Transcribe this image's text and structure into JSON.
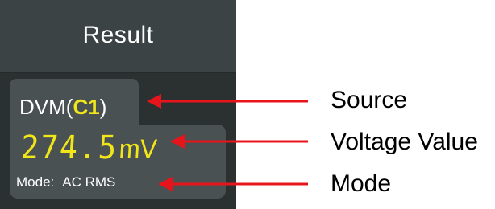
{
  "panel": {
    "title": "Result"
  },
  "dvm": {
    "tab_prefix": "DVM(",
    "source": "C1",
    "tab_suffix": ")",
    "value": "274.5",
    "unit": "mV",
    "mode_label": "Mode:",
    "mode_value": "AC RMS"
  },
  "annotations": {
    "source": "Source",
    "voltage_value": "Voltage Value",
    "mode": "Mode"
  },
  "colors": {
    "panel_bg": "#2f3435",
    "card_bg": "#4a5152",
    "value_yellow": "#f0e61a",
    "arrow_red": "#e8141b"
  }
}
